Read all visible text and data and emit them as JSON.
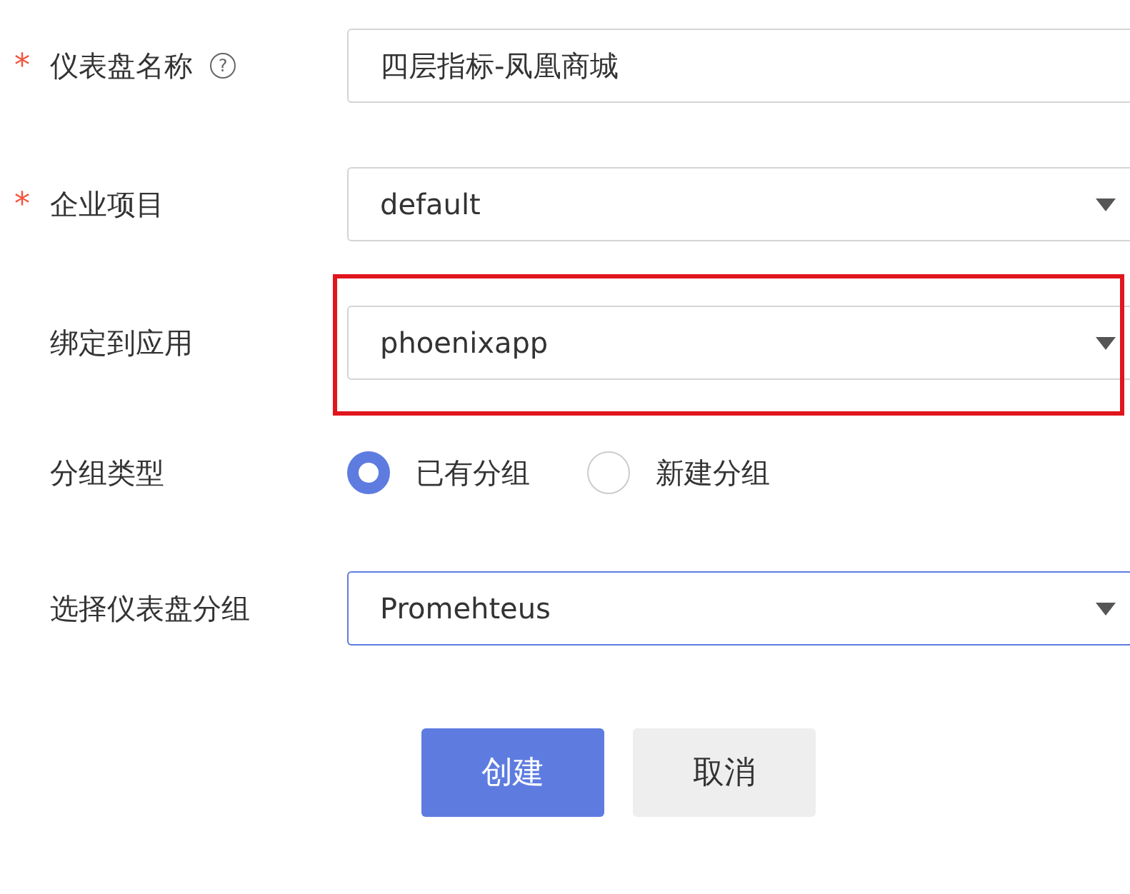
{
  "form": {
    "rows": [
      {
        "kind": "text",
        "marker": "*",
        "label": "仪表盘名称",
        "help": "?",
        "value": "四层指标-凤凰商城",
        "focused": false,
        "highlighted": false
      },
      {
        "kind": "select",
        "marker": "*",
        "label": "企业项目",
        "value": "default",
        "focused": false,
        "highlighted": false
      },
      {
        "kind": "select",
        "label": "绑定到应用",
        "value": "phoenixapp",
        "focused": false,
        "highlighted": true
      },
      {
        "kind": "radio",
        "label": "分组类型",
        "options": [
          {
            "label": "已有分组",
            "selected": true
          },
          {
            "label": "新建分组",
            "selected": false
          }
        ]
      },
      {
        "kind": "select",
        "label": "选择仪表盘分组",
        "value": "Promehteus",
        "focused": true,
        "highlighted": false
      }
    ]
  },
  "buttons": [
    {
      "label": "创建",
      "kind": "primary"
    },
    {
      "label": "取消",
      "kind": "secondary"
    }
  ]
}
